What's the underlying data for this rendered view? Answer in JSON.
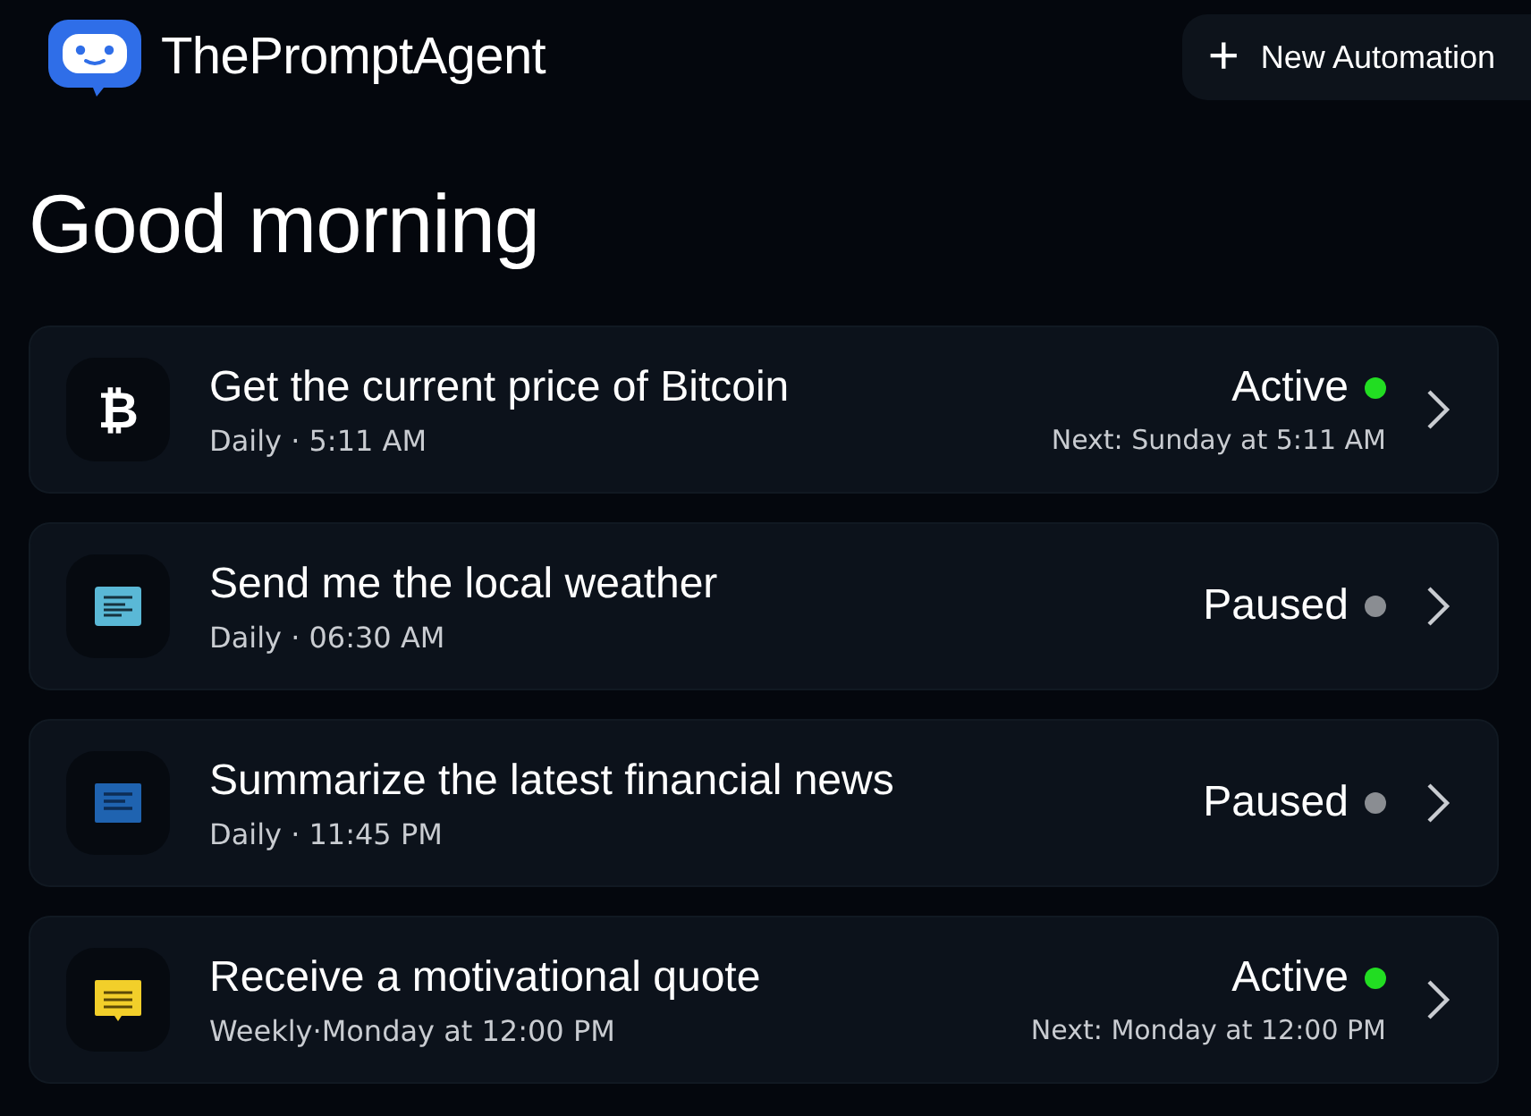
{
  "app": {
    "name": "ThePromptAgent"
  },
  "new_button": {
    "label": "New Automation",
    "icon": "+"
  },
  "greeting": "Good morning",
  "automations": [
    {
      "kind": "bitcoin",
      "icon_text": "₿",
      "title": "Get the current price of Bitcoin",
      "schedule": "Daily · 5:11 AM",
      "status": "Active",
      "color": "#22dd22",
      "next": "Next: Sunday at 5:11 AM"
    },
    {
      "kind": "document",
      "title": "Send me the local weather",
      "schedule": "Daily · 06:30 AM",
      "status": "Paused",
      "color": "#8a8d92"
    },
    {
      "kind": "news",
      "title": "Summarize the latest financial news",
      "schedule": "Daily · 11:45 PM",
      "status": "Paused",
      "color": "#8a8d92"
    },
    {
      "kind": "chat",
      "title": "Receive a motivational quote",
      "schedule": "Weekly·Monday at 12:00 PM",
      "status": "Active",
      "color": "#22dd22",
      "next": "Next: Monday at 12:00 PM"
    }
  ]
}
